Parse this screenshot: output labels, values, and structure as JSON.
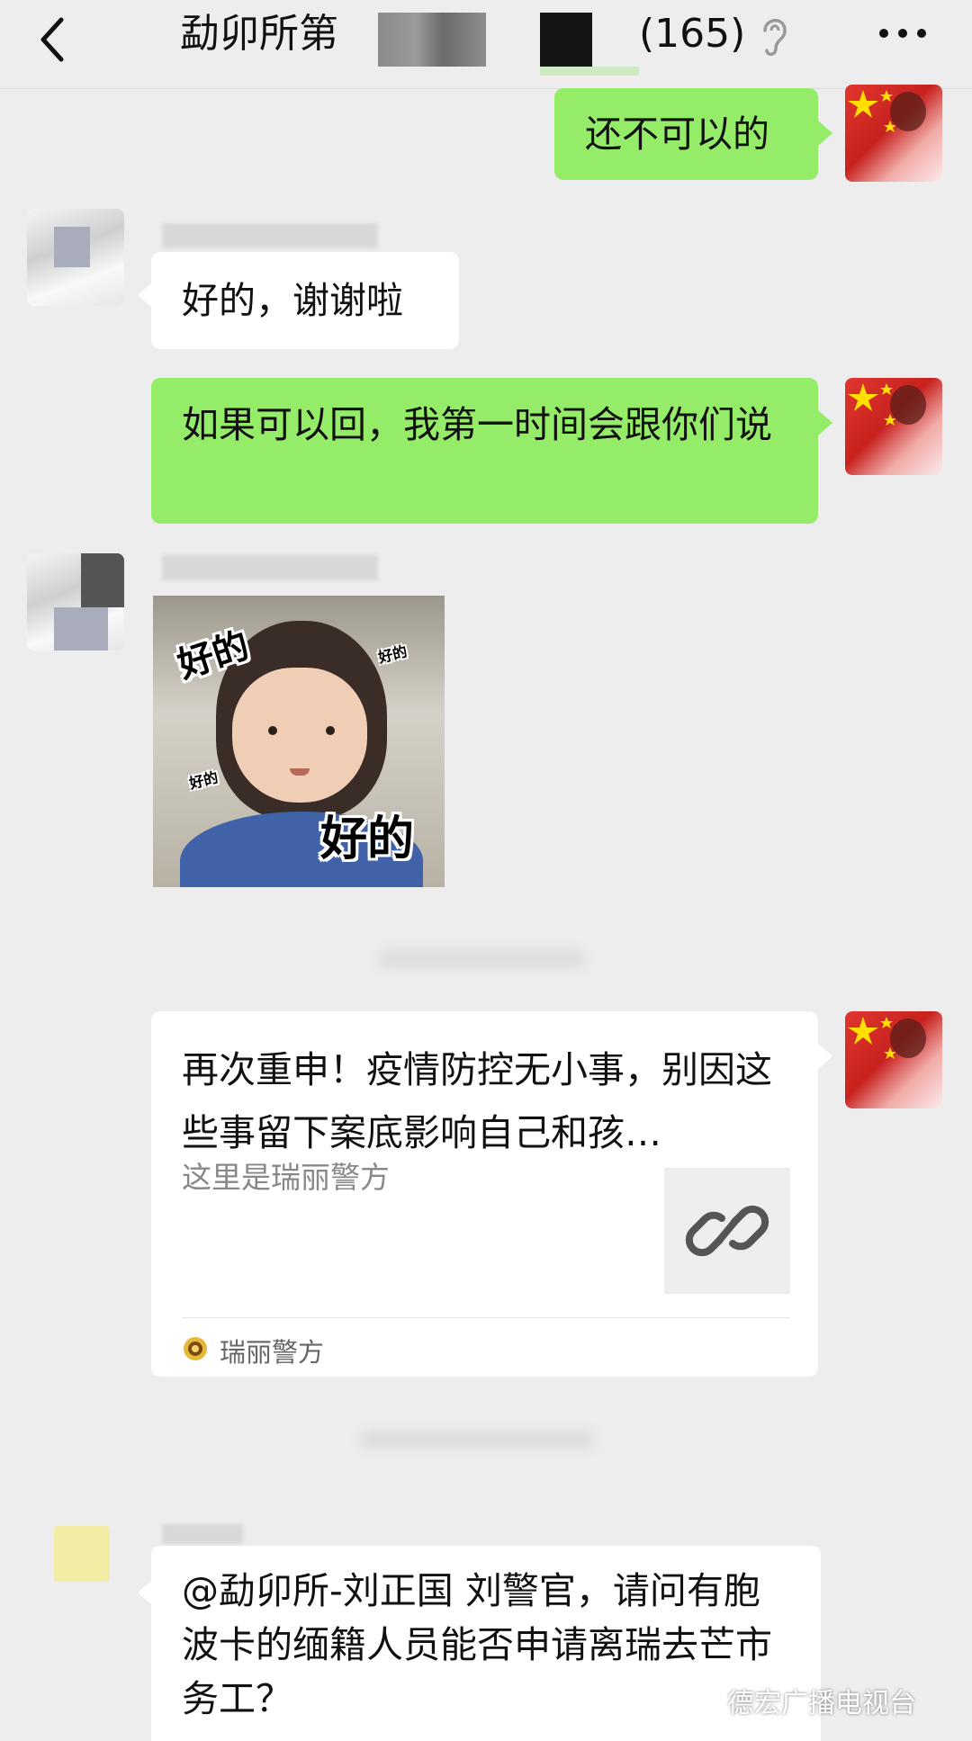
{
  "header": {
    "title": "勐卯所第",
    "member_count": "(165)"
  },
  "messages": {
    "m1": "还不可以的",
    "m2": "好的，谢谢啦",
    "m3": "如果可以回，我第一时间会跟你们说",
    "sticker": {
      "big_text": "好的",
      "top_text": "好的",
      "small_text_1": "好的",
      "small_text_2": "好的"
    },
    "m5": "@勐卯所-刘正国  刘警官，请问有胞波卡的缅籍人员能否申请离瑞去芒市务工？"
  },
  "link_card": {
    "title": "再次重申！疫情防控无小事，别因这些事留下案底影响自己和孩…",
    "description": "这里是瑞丽警方",
    "source": "瑞丽警方"
  },
  "watermark": "德宏广播电视台",
  "colors": {
    "background": "#ededed",
    "bubble_me": "#95ec69",
    "bubble_other": "#ffffff"
  },
  "icons": [
    "back-chevron-icon",
    "ear-icon",
    "more-icon",
    "link-icon",
    "police-badge-icon",
    "wechat-logo-icon"
  ]
}
